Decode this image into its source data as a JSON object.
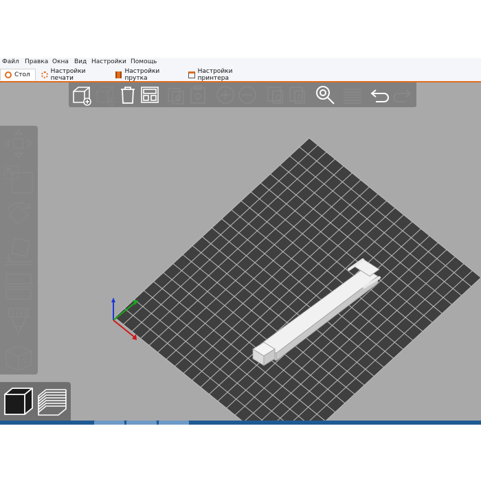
{
  "menu": [
    "Файл",
    "Правка",
    "Окна",
    "Вид",
    "Настройки",
    "Помощь"
  ],
  "tabs": [
    {
      "label": "Стол",
      "icon": "plater-icon",
      "active": true
    },
    {
      "label": "Настройки печати",
      "icon": "print-settings-gear-icon",
      "active": false
    },
    {
      "label": "Настройки прутка",
      "icon": "filament-icon",
      "active": false
    },
    {
      "label": "Настройки принтера",
      "icon": "printer-icon",
      "active": false
    }
  ],
  "toolbar": [
    {
      "name": "add-object-icon",
      "enabled": true
    },
    {
      "name": "delete-object-icon",
      "enabled": false
    },
    {
      "name": "delete-all-icon",
      "enabled": true
    },
    {
      "name": "arrange-icon",
      "enabled": true
    },
    {
      "name": "copy-icon",
      "enabled": false
    },
    {
      "name": "paste-icon",
      "enabled": false
    },
    {
      "name": "add-instance-icon",
      "enabled": false
    },
    {
      "name": "remove-instance-icon",
      "enabled": false
    },
    {
      "name": "split-objects-icon",
      "enabled": false
    },
    {
      "name": "split-parts-icon",
      "enabled": false
    },
    {
      "name": "search-icon",
      "enabled": true
    },
    {
      "name": "layers-editing-icon",
      "enabled": false
    },
    {
      "name": "undo-icon",
      "enabled": true
    },
    {
      "name": "redo-icon",
      "enabled": false
    }
  ],
  "gizmos": [
    "move-gizmo-icon",
    "scale-gizmo-icon",
    "rotate-gizmo-icon",
    "place-on-face-icon",
    "cut-icon",
    "support-paint-icon",
    "seam-paint-icon"
  ],
  "view_modes": [
    {
      "name": "3d-view-icon",
      "active": true
    },
    {
      "name": "preview-layers-icon",
      "active": false
    }
  ],
  "colors": {
    "accent": "#e36c1c",
    "viewport_bg": "#a9a9a9",
    "bed": "#3f3f3f",
    "grid": "#bdbdbd",
    "axis_x": "#d01818",
    "axis_y": "#18a818",
    "axis_z": "#1838d8",
    "model": "#e6e6e6"
  }
}
